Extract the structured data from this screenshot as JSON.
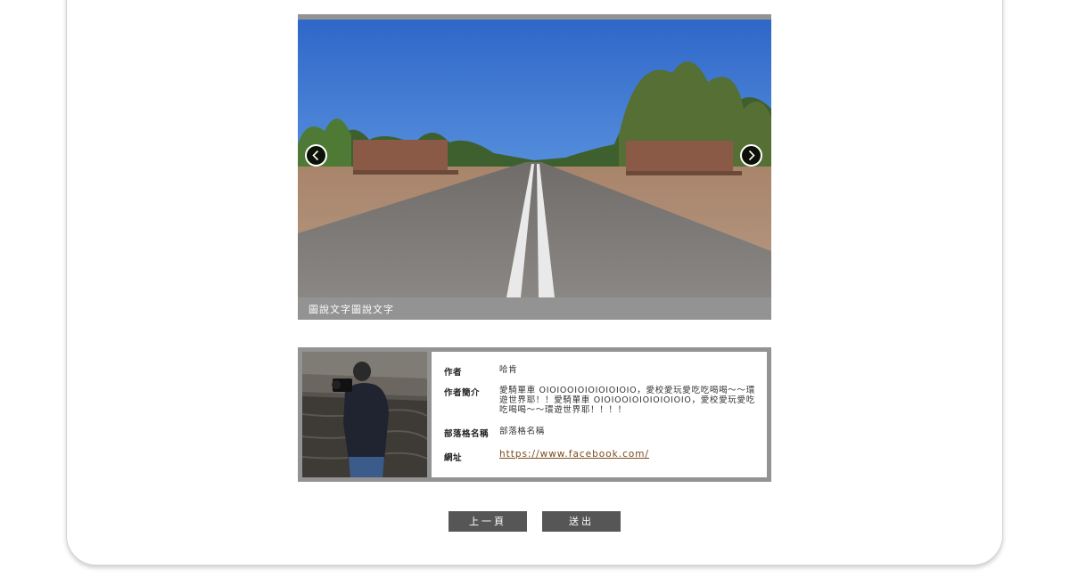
{
  "slider": {
    "caption": "圖說文字圖說文字",
    "prev_icon": "chevron-left-icon",
    "next_icon": "chevron-right-icon"
  },
  "author": {
    "name_label": "作者",
    "name": "哈肯",
    "bio_label": "作者簡介",
    "bio": "愛騎單車 OIOIOOIOIOIOIOIOIO，愛校愛玩愛吃吃喝喝～～環遊世界耶！！愛騎單車 OIOIOOIOIOIOIOIOIO，愛校愛玩愛吃吃喝喝～～環遊世界耶！！！！",
    "blog_label": "部落格名稱",
    "blog_name": "部落格名稱",
    "url_label": "網址",
    "url": "https://www.facebook.com/"
  },
  "buttons": {
    "prev_label": "上一頁",
    "submit_label": "送出"
  }
}
